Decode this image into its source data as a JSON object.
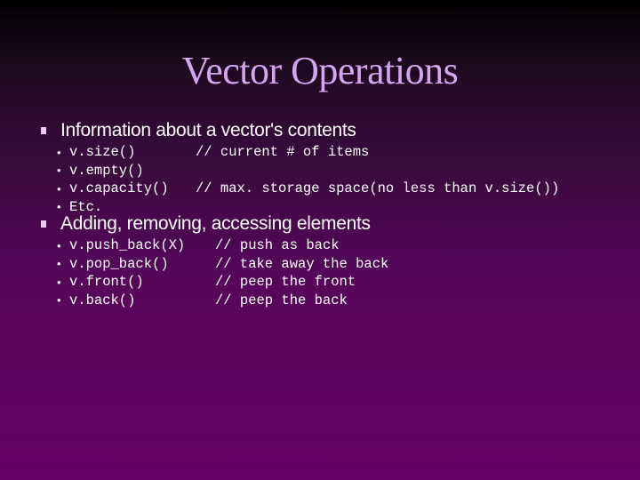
{
  "slide": {
    "title": "Vector Operations",
    "sections": [
      {
        "label": "Information about a vector's contents",
        "items": [
          {
            "code": "v.size()",
            "comment": "// current # of items"
          },
          {
            "code": "v.empty()",
            "comment": ""
          },
          {
            "code": "v.capacity()",
            "comment": "// max. storage space(no less than v.size())"
          },
          {
            "code": "Etc.",
            "comment": ""
          }
        ]
      },
      {
        "label": "Adding, removing, accessing elements",
        "items": [
          {
            "code": "v.push_back(X)",
            "comment": "// push as back"
          },
          {
            "code": "v.pop_back()",
            "comment": "// take away the back"
          },
          {
            "code": "v.front()",
            "comment": "// peep the front"
          },
          {
            "code": "v.back()",
            "comment": "// peep the back"
          }
        ]
      }
    ]
  },
  "icons": {
    "section_bullet": "square-bullet-icon",
    "item_bullet": "•"
  },
  "colors": {
    "title": "#d4a6ef",
    "text": "#ffffff",
    "background_top": "#000000",
    "background_bottom": "#650064"
  }
}
